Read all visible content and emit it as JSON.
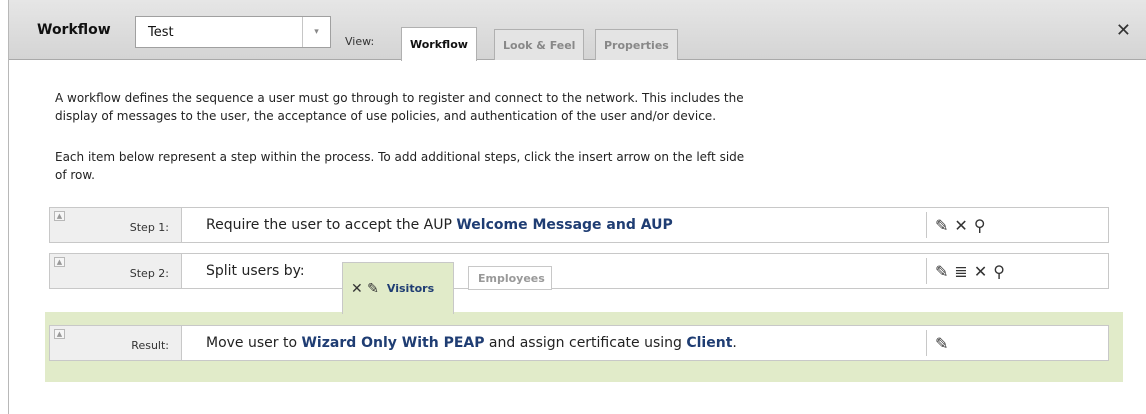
{
  "header": {
    "title": "Workflow",
    "select_value": "Test",
    "select_arrow": "▾",
    "view_label": "View:",
    "tabs": [
      {
        "label": "Workflow"
      },
      {
        "label": "Look & Feel"
      },
      {
        "label": "Properties"
      }
    ],
    "close": "✕"
  },
  "description": {
    "para1_line1": "A workflow defines the sequence a user must go through to register and connect to the network. This includes the",
    "para1_line2": "display of messages to the user, the acceptance of use policies, and authentication of the user and/or device.",
    "para2_line1": "Each item below represent a step within the process. To add additional steps, click the insert arrow on the left side",
    "para2_line2": "of row."
  },
  "steps": [
    {
      "label": "Step 1:",
      "text_prefix": "Require the user to accept the AUP ",
      "text_bold": "Welcome Message and AUP",
      "tools": [
        "✎",
        "✕",
        "⚲"
      ]
    },
    {
      "label": "Step 2:",
      "text_prefix": "Split users by:",
      "tools": [
        "✎",
        "≣",
        "✕",
        "⚲"
      ],
      "branches": [
        {
          "label": "Visitors",
          "icons": "✕ ✎"
        },
        {
          "label": "Employees"
        }
      ]
    }
  ],
  "result": {
    "label": "Result:",
    "t1": "Move user to ",
    "b1": "Wizard Only With PEAP",
    "t2": " and assign certificate using ",
    "b2": "Client",
    "t3": ".",
    "tools": [
      "✎"
    ]
  },
  "colors": {
    "link_text": "#1f3d73",
    "result_band": "#e1ebc9",
    "header_bg": "#dcdcdc"
  },
  "icons": {
    "insert": "▲"
  }
}
